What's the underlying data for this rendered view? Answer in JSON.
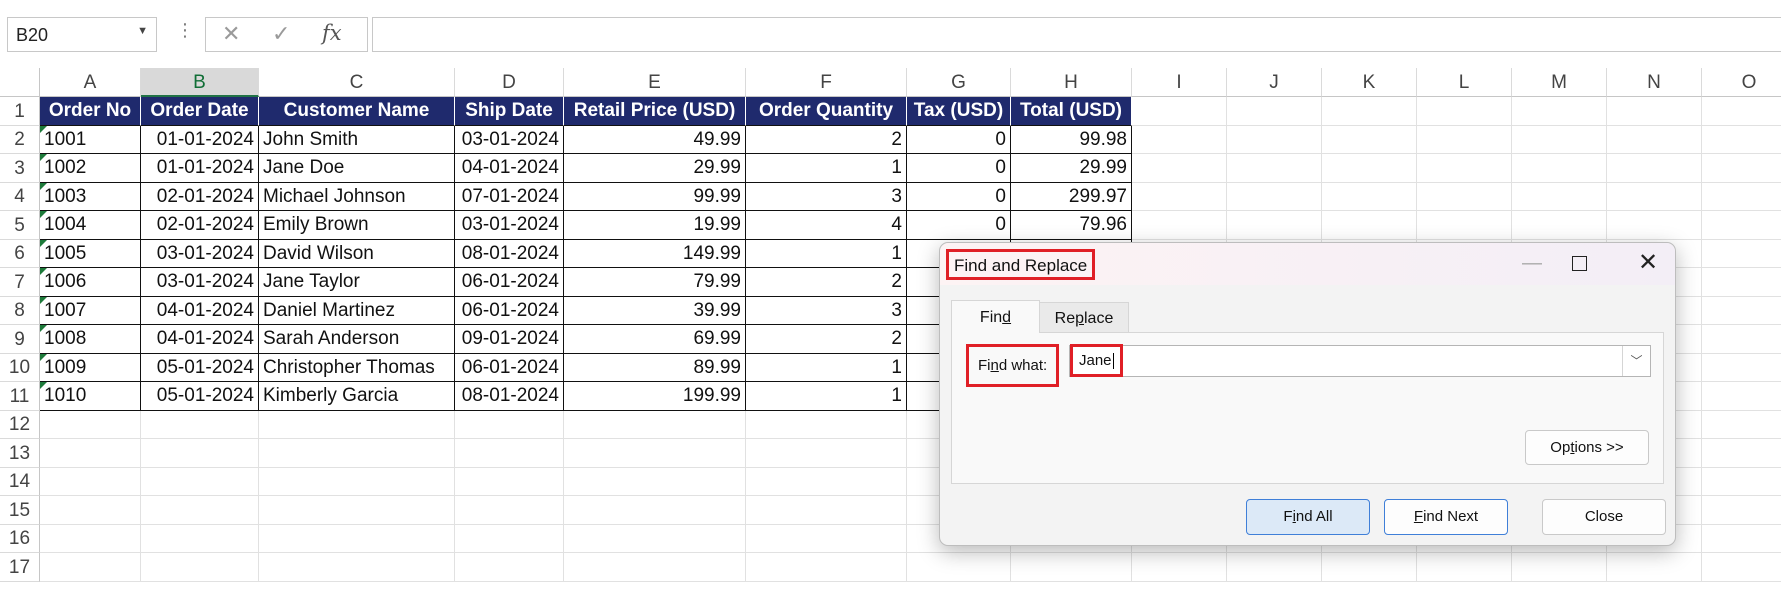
{
  "formula_bar": {
    "name_box": "B20",
    "cancel_glyph": "✕",
    "enter_glyph": "✓",
    "fx_label": "fx",
    "formula": ""
  },
  "columns": [
    "A",
    "B",
    "C",
    "D",
    "E",
    "F",
    "G",
    "H",
    "I",
    "J",
    "K",
    "L",
    "M",
    "N",
    "O"
  ],
  "selected_column": "B",
  "rows": [
    "1",
    "2",
    "3",
    "4",
    "5",
    "6",
    "7",
    "8",
    "9",
    "10",
    "11",
    "12",
    "13",
    "14",
    "15",
    "16",
    "17"
  ],
  "table": {
    "headers": [
      "Order No",
      "Order Date",
      "Customer Name",
      "Ship Date",
      "Retail Price (USD)",
      "Order Quantity",
      "Tax (USD)",
      "Total (USD)"
    ],
    "data": [
      [
        "1001",
        "01-01-2024",
        "John Smith",
        "03-01-2024",
        "49.99",
        "2",
        "0",
        "99.98"
      ],
      [
        "1002",
        "01-01-2024",
        "Jane Doe",
        "04-01-2024",
        "29.99",
        "1",
        "0",
        "29.99"
      ],
      [
        "1003",
        "02-01-2024",
        "Michael Johnson",
        "07-01-2024",
        "99.99",
        "3",
        "0",
        "299.97"
      ],
      [
        "1004",
        "02-01-2024",
        "Emily Brown",
        "03-01-2024",
        "19.99",
        "4",
        "0",
        "79.96"
      ],
      [
        "1005",
        "03-01-2024",
        "David Wilson",
        "08-01-2024",
        "149.99",
        "1",
        "",
        ""
      ],
      [
        "1006",
        "03-01-2024",
        "Jane Taylor",
        "06-01-2024",
        "79.99",
        "2",
        "",
        ""
      ],
      [
        "1007",
        "04-01-2024",
        "Daniel Martinez",
        "06-01-2024",
        "39.99",
        "3",
        "",
        ""
      ],
      [
        "1008",
        "04-01-2024",
        "Sarah Anderson",
        "09-01-2024",
        "69.99",
        "2",
        "",
        ""
      ],
      [
        "1009",
        "05-01-2024",
        "Christopher Thomas",
        "06-01-2024",
        "89.99",
        "1",
        "",
        ""
      ],
      [
        "1010",
        "05-01-2024",
        "Kimberly Garcia",
        "08-01-2024",
        "199.99",
        "1",
        "",
        ""
      ]
    ]
  },
  "dialog": {
    "title": "Find and Replace",
    "tabs": {
      "find": {
        "pre": "Fin",
        "key": "d",
        "post": ""
      },
      "replace": {
        "pre": "Re",
        "key": "p",
        "post": "lace"
      }
    },
    "find_what_label": {
      "pre": "Fi",
      "key": "n",
      "post": "d what:"
    },
    "find_what_value": "Jane",
    "options": {
      "pre": "Op",
      "key": "t",
      "post": "ions >>"
    },
    "buttons": {
      "find_all": {
        "pre": "F",
        "key": "i",
        "post": "nd All"
      },
      "find_next": {
        "pre": "",
        "key": "F",
        "post": "ind Next"
      },
      "close": "Close"
    }
  },
  "colors": {
    "table_header_bg": "#1f2a6d",
    "highlight_box": "#e01f26",
    "selected_col": "#217346"
  }
}
